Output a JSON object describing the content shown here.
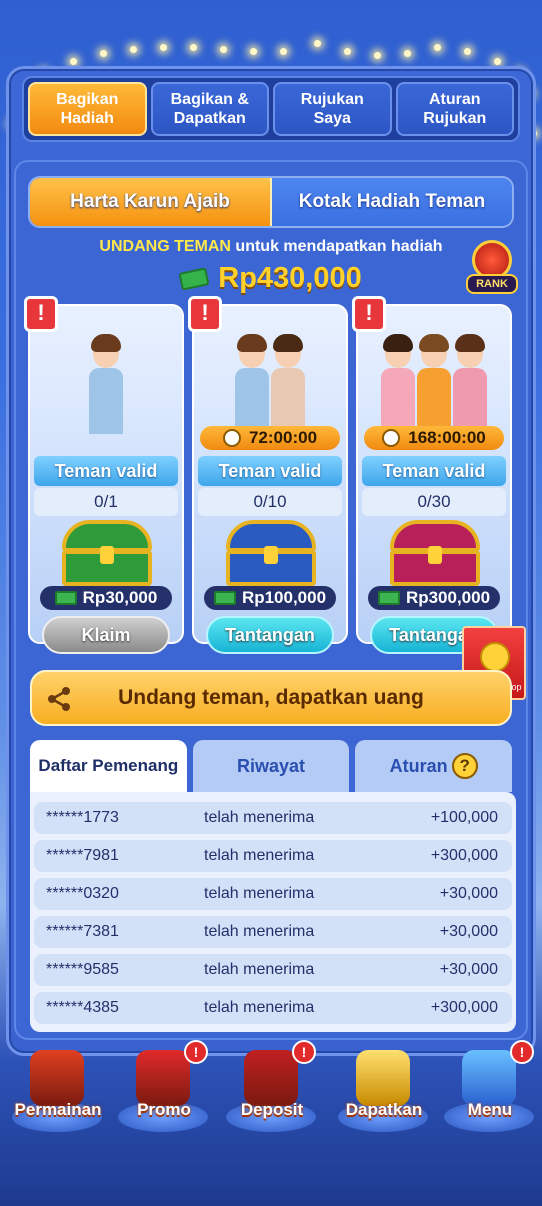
{
  "top_tabs": [
    {
      "label": "Bagikan\nHadiah",
      "active": true
    },
    {
      "label": "Bagikan &\nDapatkan",
      "active": false
    },
    {
      "label": "Rujukan\nSaya",
      "active": false
    },
    {
      "label": "Aturan\nRujukan",
      "active": false
    }
  ],
  "sub_tabs": [
    {
      "label": "Harta Karun Ajaib",
      "active": true
    },
    {
      "label": "Kotak Hadiah Teman",
      "active": false
    }
  ],
  "invite": {
    "highlight": "UNDANG TEMAN",
    "rest": "untuk mendapatkan hadiah"
  },
  "total_amount": "Rp430,000",
  "rank_label": "RANK",
  "cards": [
    {
      "alert": "!",
      "timer": "",
      "valid_label": "Teman valid",
      "count": "0/1",
      "prize": "Rp30,000",
      "button": "Klaim",
      "chest_color": "#2f9a3a"
    },
    {
      "alert": "!",
      "timer": "72:00:00",
      "valid_label": "Teman valid",
      "count": "0/10",
      "prize": "Rp100,000",
      "button": "Tantangan",
      "chest_color": "#2a5bc0"
    },
    {
      "alert": "!",
      "timer": "168:00:00",
      "valid_label": "Teman valid",
      "count": "0/30",
      "prize": "Rp300,000",
      "button": "Tantangan",
      "chest_color": "#b8205a"
    }
  ],
  "amplop_label": "Klaim Amplop",
  "share_label": "Undang teman, dapatkan uang",
  "lower_tabs": [
    {
      "label": "Daftar Pemenang",
      "active": true
    },
    {
      "label": "Riwayat",
      "active": false
    },
    {
      "label": "Aturan",
      "active": false
    }
  ],
  "winners": [
    {
      "user": "******1773",
      "msg": "telah menerima",
      "value": "+100,000"
    },
    {
      "user": "******7981",
      "msg": "telah menerima",
      "value": "+300,000"
    },
    {
      "user": "******0320",
      "msg": "telah menerima",
      "value": "+30,000"
    },
    {
      "user": "******7381",
      "msg": "telah menerima",
      "value": "+30,000"
    },
    {
      "user": "******9585",
      "msg": "telah menerima",
      "value": "+30,000"
    },
    {
      "user": "******4385",
      "msg": "telah menerima",
      "value": "+300,000"
    }
  ],
  "bottom_nav": [
    {
      "label": "Permainan",
      "icon": "slot-machine-icon",
      "badge": ""
    },
    {
      "label": "Promo",
      "icon": "gift-box-icon",
      "badge": "!"
    },
    {
      "label": "Deposit",
      "icon": "treasure-chest-icon",
      "badge": "!"
    },
    {
      "label": "Dapatkan",
      "icon": "phone-coins-icon",
      "badge": ""
    },
    {
      "label": "Menu",
      "icon": "menu-tv-icon",
      "badge": "!"
    }
  ],
  "colors": {
    "accent_orange": "#f5920f",
    "brand_blue": "#3c66d4",
    "gold": "#ffd12a"
  }
}
